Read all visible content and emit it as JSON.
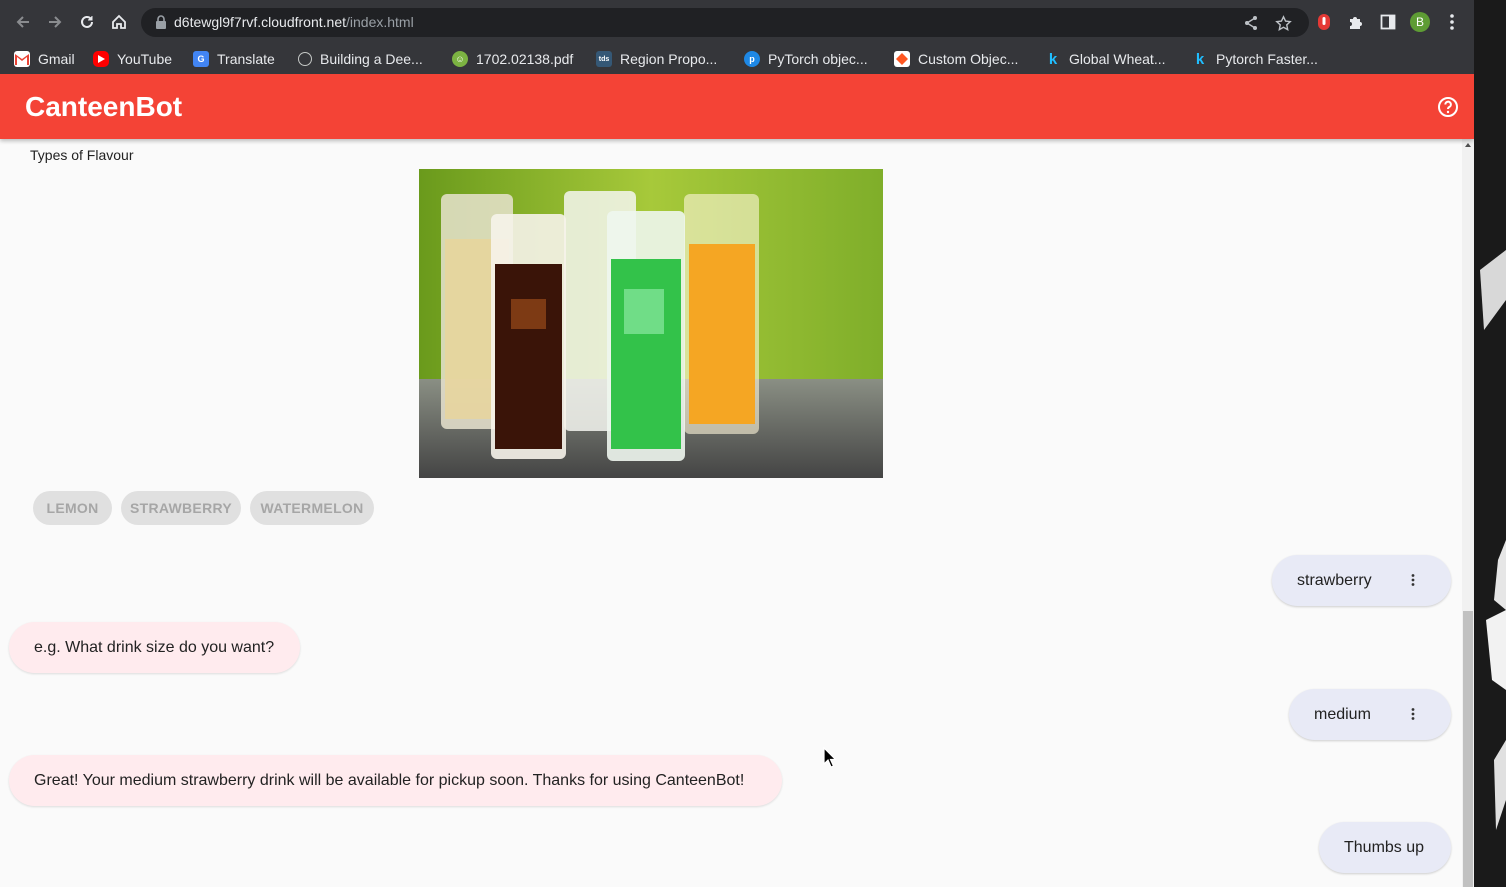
{
  "browser": {
    "url_host": "d6tewgl9f7rvf.cloudfront.net",
    "url_path": "/index.html",
    "profile_initial": "B",
    "bookmarks": [
      {
        "label": "Gmail",
        "icon": "gmail-icon",
        "color": "#ea4335"
      },
      {
        "label": "YouTube",
        "icon": "youtube-icon",
        "color": "#ff0000"
      },
      {
        "label": "Translate",
        "icon": "translate-icon",
        "color": "#4285f4"
      },
      {
        "label": "Building a Dee...",
        "icon": "site-icon",
        "color": "#3c4043"
      },
      {
        "label": "1702.02138.pdf",
        "icon": "pdf-icon",
        "color": "#7cb342"
      },
      {
        "label": "Region Propo...",
        "icon": "tds-icon",
        "color": "#355876"
      },
      {
        "label": "PyTorch objec...",
        "icon": "pytorch-icon",
        "color": "#1e88e5"
      },
      {
        "label": "Custom Objec...",
        "icon": "custom-icon",
        "color": "#ff5722"
      },
      {
        "label": "Global Wheat...",
        "icon": "kaggle-icon",
        "color": "#20beff"
      },
      {
        "label": "Pytorch Faster...",
        "icon": "kaggle-icon",
        "color": "#20beff"
      }
    ]
  },
  "app": {
    "title": "CanteenBot",
    "accent": "#f44336",
    "card_title": "Types of Flavour",
    "chips": [
      "LEMON",
      "STRAWBERRY",
      "WATERMELON"
    ],
    "messages": [
      {
        "from": "user",
        "text": "strawberry",
        "has_menu": true
      },
      {
        "from": "bot",
        "text": "e.g. What drink size do you want?"
      },
      {
        "from": "user",
        "text": "medium",
        "has_menu": true
      },
      {
        "from": "bot",
        "text": "Great! Your medium strawberry drink will be available for pickup soon. Thanks for using CanteenBot!"
      },
      {
        "from": "user",
        "text": "Thumbs up",
        "has_menu": false
      }
    ]
  }
}
